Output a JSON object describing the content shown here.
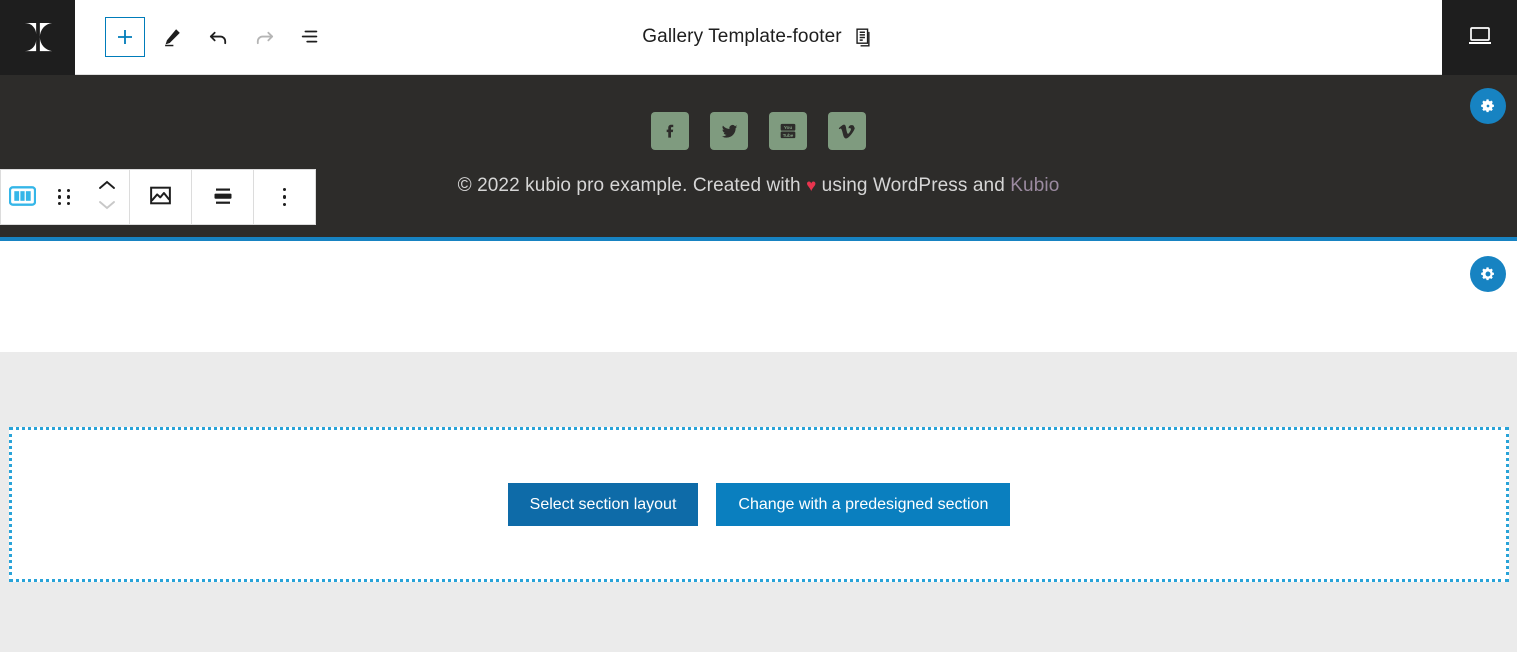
{
  "topbar": {
    "logo_name": "kubio-logo",
    "title": "Gallery Template-footer",
    "tools": [
      {
        "name": "add-block-button",
        "label": "Add block",
        "icon": "plus-icon",
        "state": "active"
      },
      {
        "name": "edit-tool-button",
        "label": "Edit",
        "icon": "pencil-icon",
        "state": "enabled"
      },
      {
        "name": "undo-button",
        "label": "Undo",
        "icon": "undo-arrow-icon",
        "state": "enabled"
      },
      {
        "name": "redo-button",
        "label": "Redo",
        "icon": "redo-arrow-icon",
        "state": "disabled"
      },
      {
        "name": "list-view-button",
        "label": "List view",
        "icon": "list-view-icon",
        "state": "enabled"
      }
    ],
    "document_icon": "document-overview-icon",
    "device_preview": {
      "name": "desktop-preview-button",
      "label": "Desktop",
      "icon": "desktop-icon"
    }
  },
  "block_toolbar": {
    "items": [
      {
        "name": "block-type-columns-button",
        "label": "Columns block",
        "icon": "columns-icon",
        "state": "active"
      },
      {
        "name": "drag-handle",
        "label": "Drag",
        "icon": "drag-dots-icon",
        "state": "enabled"
      },
      {
        "name": "move-up-button",
        "label": "Move up",
        "icon": "chevron-up-icon",
        "state": "enabled"
      },
      {
        "name": "move-down-button",
        "label": "Move down",
        "icon": "chevron-down-icon",
        "state": "disabled"
      },
      {
        "name": "background-image-button",
        "label": "Background image",
        "icon": "image-icon",
        "state": "enabled"
      },
      {
        "name": "vertical-align-button",
        "label": "Change vertical alignment",
        "icon": "align-center-icon",
        "state": "enabled"
      },
      {
        "name": "more-options-button",
        "label": "Options",
        "icon": "kebab-menu-icon",
        "state": "enabled"
      }
    ]
  },
  "footer_preview": {
    "social_links": [
      {
        "name": "facebook-link",
        "label": "Facebook",
        "icon": "facebook-icon"
      },
      {
        "name": "twitter-link",
        "label": "Twitter",
        "icon": "twitter-icon"
      },
      {
        "name": "youtube-link",
        "label": "YouTube",
        "icon": "youtube-icon"
      },
      {
        "name": "vimeo-link",
        "label": "Vimeo",
        "icon": "vimeo-icon"
      }
    ],
    "copyright": {
      "before_heart": "© 2022 kubio pro example. Created with ",
      "heart": "♥",
      "after_heart": " using WordPress and ",
      "link_text": "Kubio"
    }
  },
  "settings_buttons": [
    {
      "name": "footer-settings-gear",
      "label": "Footer settings",
      "icon": "gear-icon"
    },
    {
      "name": "section-settings-gear",
      "label": "Section settings",
      "icon": "gear-icon"
    }
  ],
  "placeholder_section": {
    "select_layout_label": "Select section layout",
    "predesigned_label": "Change with a predesigned section"
  },
  "colors": {
    "accent_blue": "#1783c2",
    "toolbar_active": "#35b6e8",
    "dotted_border": "#29a3d8",
    "dark_footer": "#2d2c2a",
    "social_icon": "#7f9b7f",
    "heart_red": "#e8344e",
    "kubio_link": "#9b8aa0",
    "gray_band": "#ebebeb",
    "button_primary": "#0e6ba8",
    "button_secondary": "#0a7fbf"
  }
}
